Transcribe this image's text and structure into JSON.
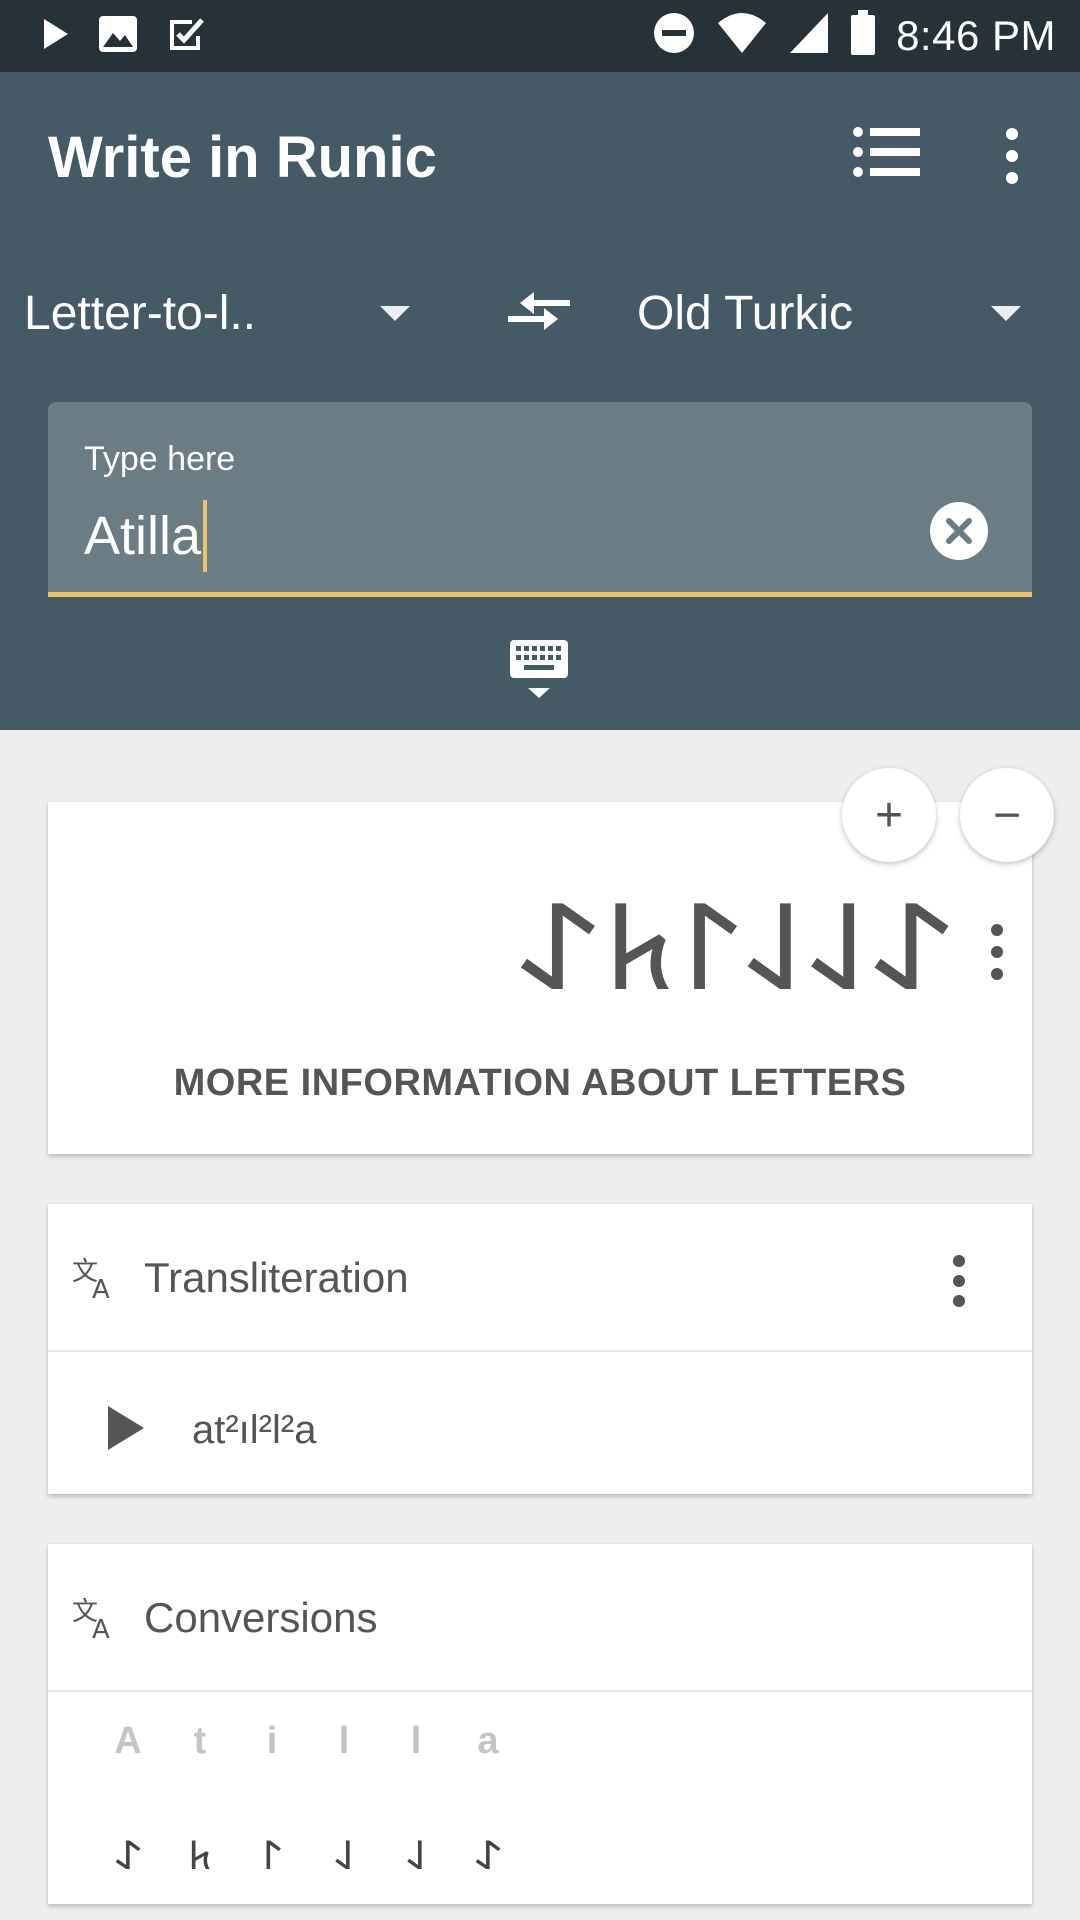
{
  "status_bar": {
    "time": "8:46 PM",
    "left_icons": [
      "play-store-icon",
      "image-icon",
      "task-check-icon"
    ],
    "right_icons": [
      "do-not-disturb-icon",
      "wifi-icon",
      "cell-signal-icon",
      "battery-icon"
    ]
  },
  "app_bar": {
    "title": "Write in Runic",
    "actions": [
      "list-icon",
      "more-vert-icon"
    ]
  },
  "mode_selector": {
    "left_value": "Letter-to-l..",
    "right_value": "Old Turkic"
  },
  "input": {
    "label": "Type here",
    "value": "Atilla"
  },
  "output_card": {
    "runes": "𐰀𐰞𐰞𐰃𐱅𐰀",
    "more_info_label": "MORE INFORMATION ABOUT LETTERS",
    "zoom_in_label": "+",
    "zoom_out_label": "−"
  },
  "transliteration_card": {
    "title": "Transliteration",
    "value": "at²ıl²l²a"
  },
  "conversions_card": {
    "title": "Conversions",
    "latin": [
      "A",
      "t",
      "i",
      "l",
      "l",
      "a"
    ],
    "runes": [
      "𐰀",
      "𐱅",
      "𐰃",
      "𐰞",
      "𐰞",
      "𐰀"
    ]
  },
  "colors": {
    "status_bar": "#263238",
    "app_bar": "#455a64",
    "input_bg": "#6b7c84",
    "accent": "#e9c46a",
    "page_bg": "#eeeeee"
  }
}
